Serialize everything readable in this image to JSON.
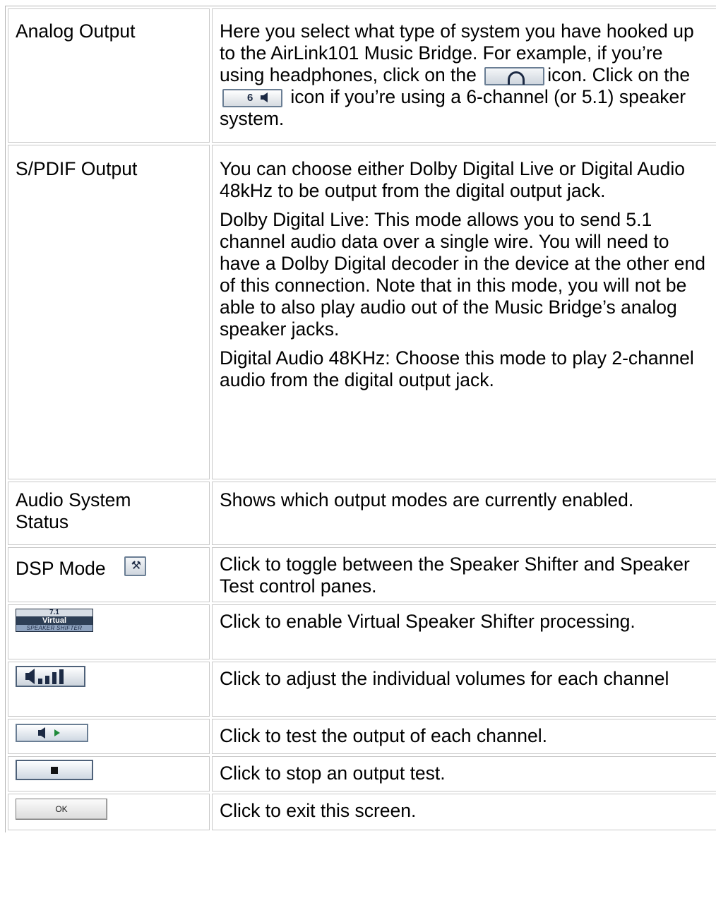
{
  "rows": [
    {
      "label": "Analog Output",
      "desc_part1": "Here you select what type of system you have hooked up to the AirLink101 Music Bridge. For example, if you’re using headphones, click on the",
      "desc_part2": "icon. Click on the",
      "desc_part3": "icon if you’re using a 6-channel (or 5.1) speaker system.",
      "icon_headphones": "headphones-icon",
      "icon_six_channel": "six-channel-speaker-icon",
      "six_channel_label": "6"
    },
    {
      "label": "S/PDIF Output",
      "para1": "You can choose either Dolby Digital Live or Digital Audio 48kHz to be output from the digital output jack.",
      "para2": "Dolby Digital Live: This mode allows you to send 5.1 channel audio data over a single wire. You will need to have a Dolby Digital decoder in the device at the other end of this connection. Note that in this mode, you will not be able to also play audio out of the Music Bridge’s analog speaker jacks.",
      "para3": "Digital Audio 48KHz: Choose this mode to play 2-channel audio from the digital output jack."
    },
    {
      "label": "Audio System Status",
      "desc": "Shows which output modes are currently enabled."
    },
    {
      "label": "DSP Mode",
      "icon": "hammer-icon",
      "desc": "Click to toggle between the Speaker Shifter and Speaker Test control panes."
    },
    {
      "icon": "virtual-speaker-shifter-icon",
      "badge_top": "7.1",
      "badge_mid": "Virtual",
      "badge_bottom": "SPEAKER SHIFTER",
      "desc": "Click to enable Virtual Speaker Shifter processing."
    },
    {
      "icon": "channel-volume-icon",
      "desc": "Click to adjust the individual volumes for each channel"
    },
    {
      "icon": "speaker-play-icon",
      "desc": "Click to test the output of each channel."
    },
    {
      "icon": "stop-icon",
      "desc": "Click to stop an output test."
    },
    {
      "ok_label": "OK",
      "desc": "Click to exit this screen."
    }
  ],
  "colors": {
    "button_border": "#4e6179",
    "button_dark": "#1c2a44",
    "badge_bg": "#2e3f56",
    "cell_border": "#c8c8c8"
  }
}
